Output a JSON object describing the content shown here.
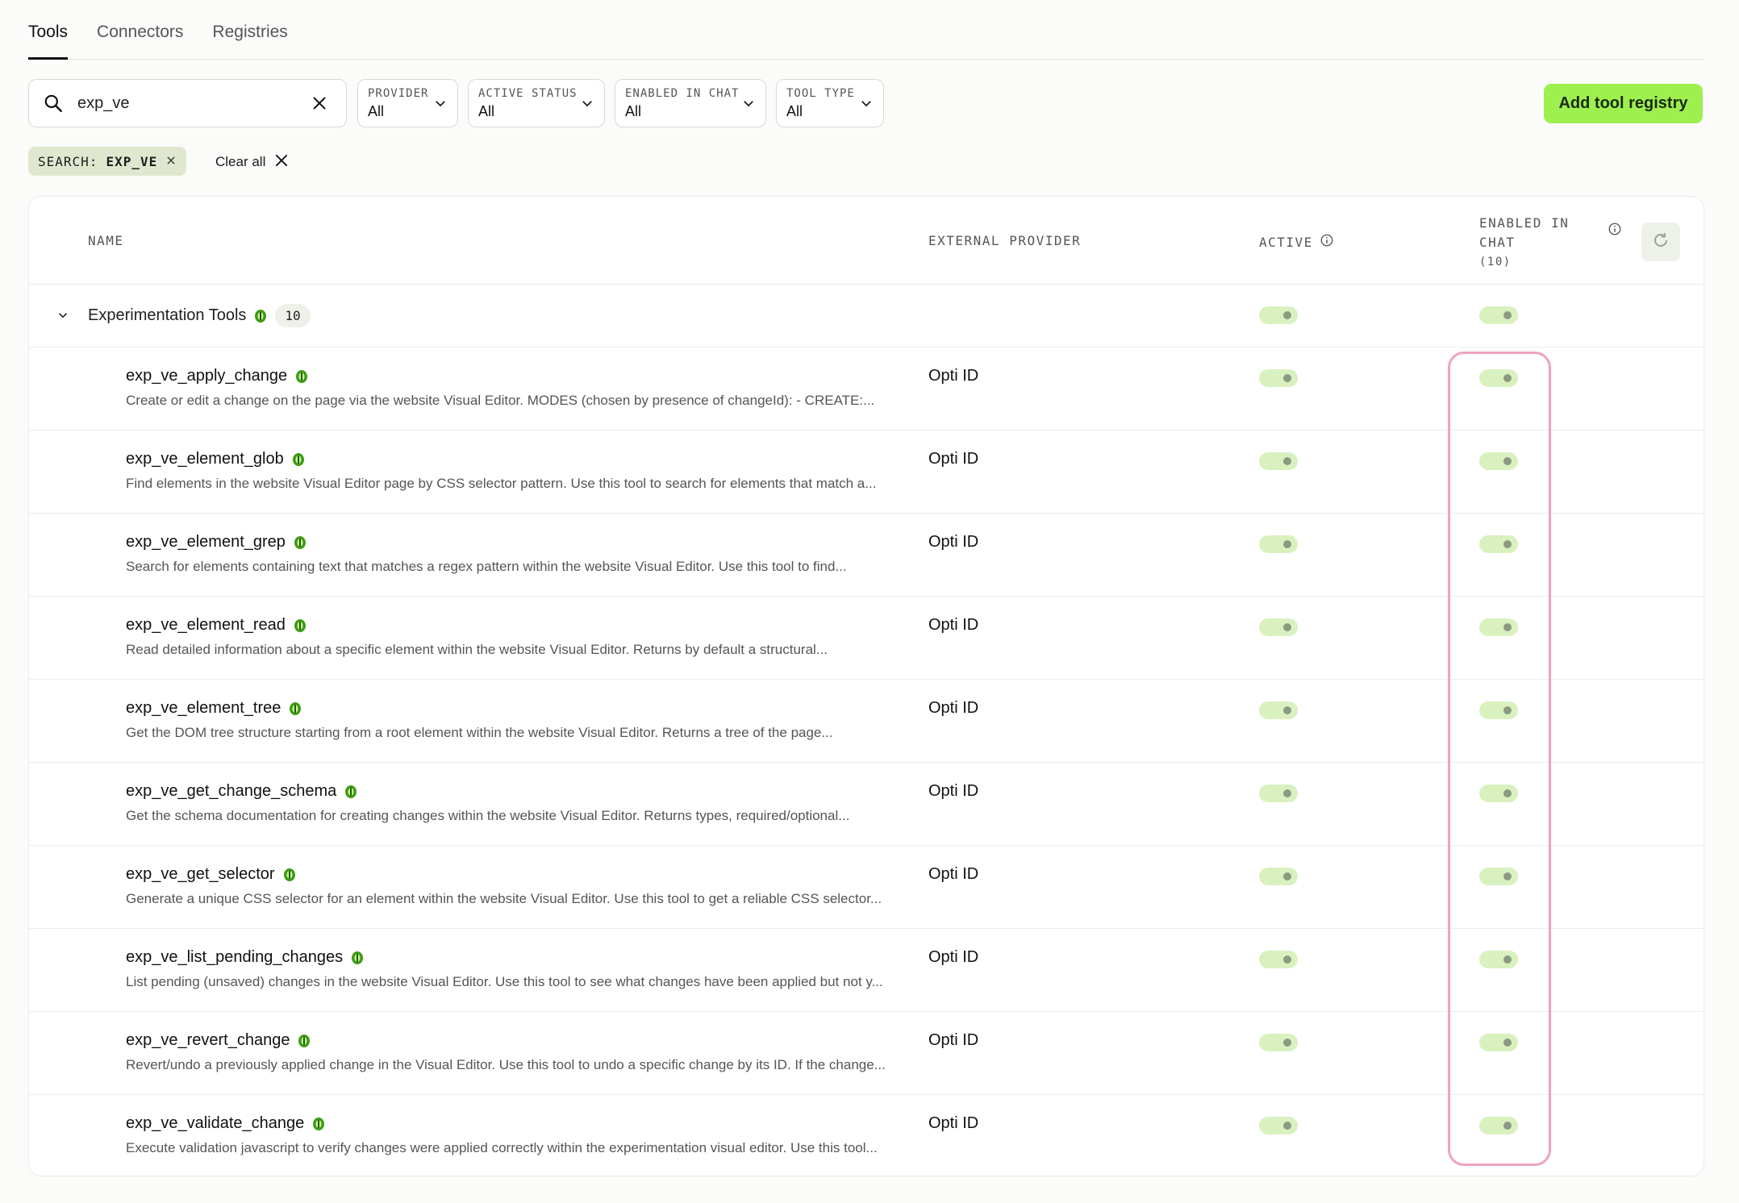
{
  "tabs": [
    {
      "label": "Tools",
      "active": true
    },
    {
      "label": "Connectors",
      "active": false
    },
    {
      "label": "Registries",
      "active": false
    }
  ],
  "search": {
    "value": "exp_ve"
  },
  "filters": [
    {
      "label": "PROVIDER",
      "value": "All"
    },
    {
      "label": "ACTIVE STATUS",
      "value": "All"
    },
    {
      "label": "ENABLED IN CHAT",
      "value": "All"
    },
    {
      "label": "TOOL TYPE",
      "value": "All"
    }
  ],
  "add_button": "Add tool registry",
  "chip": {
    "key": "SEARCH:",
    "value": "EXP_VE"
  },
  "clear_all": "Clear all",
  "table": {
    "headers": {
      "name": "NAME",
      "provider": "EXTERNAL PROVIDER",
      "active": "ACTIVE",
      "enabled_line1": "ENABLED IN",
      "enabled_line2": "CHAT",
      "enabled_count": "(10)"
    },
    "group": {
      "name": "Experimentation Tools",
      "count": "10"
    },
    "rows": [
      {
        "name": "exp_ve_apply_change",
        "desc": "Create or edit a change on the page via the website Visual Editor. MODES (chosen by presence of changeId): - CREATE:...",
        "provider": "Opti ID"
      },
      {
        "name": "exp_ve_element_glob",
        "desc": "Find elements in the website Visual Editor page by CSS selector pattern. Use this tool to search for elements that match a...",
        "provider": "Opti ID"
      },
      {
        "name": "exp_ve_element_grep",
        "desc": "Search for elements containing text that matches a regex pattern within the website Visual Editor. Use this tool to find...",
        "provider": "Opti ID"
      },
      {
        "name": "exp_ve_element_read",
        "desc": "Read detailed information about a specific element within the website Visual Editor. Returns by default a structural...",
        "provider": "Opti ID"
      },
      {
        "name": "exp_ve_element_tree",
        "desc": "Get the DOM tree structure starting from a root element within the website Visual Editor. Returns a tree of the page...",
        "provider": "Opti ID"
      },
      {
        "name": "exp_ve_get_change_schema",
        "desc": "Get the schema documentation for creating changes within the website Visual Editor. Returns types, required/optional...",
        "provider": "Opti ID"
      },
      {
        "name": "exp_ve_get_selector",
        "desc": "Generate a unique CSS selector for an element within the website Visual Editor. Use this tool to get a reliable CSS selector...",
        "provider": "Opti ID"
      },
      {
        "name": "exp_ve_list_pending_changes",
        "desc": "List pending (unsaved) changes in the website Visual Editor. Use this tool to see what changes have been applied but not y...",
        "provider": "Opti ID"
      },
      {
        "name": "exp_ve_revert_change",
        "desc": "Revert/undo a previously applied change in the Visual Editor. Use this tool to undo a specific change by its ID. If the change...",
        "provider": "Opti ID"
      },
      {
        "name": "exp_ve_validate_change",
        "desc": "Execute validation javascript to verify changes were applied correctly within the experimentation visual editor. Use this tool...",
        "provider": "Opti ID"
      }
    ]
  },
  "colors": {
    "accent": "#9ef04f",
    "toggle_bg": "#d9f1bf",
    "highlight": "#f0a2bd",
    "badge": "#3d9b14"
  }
}
